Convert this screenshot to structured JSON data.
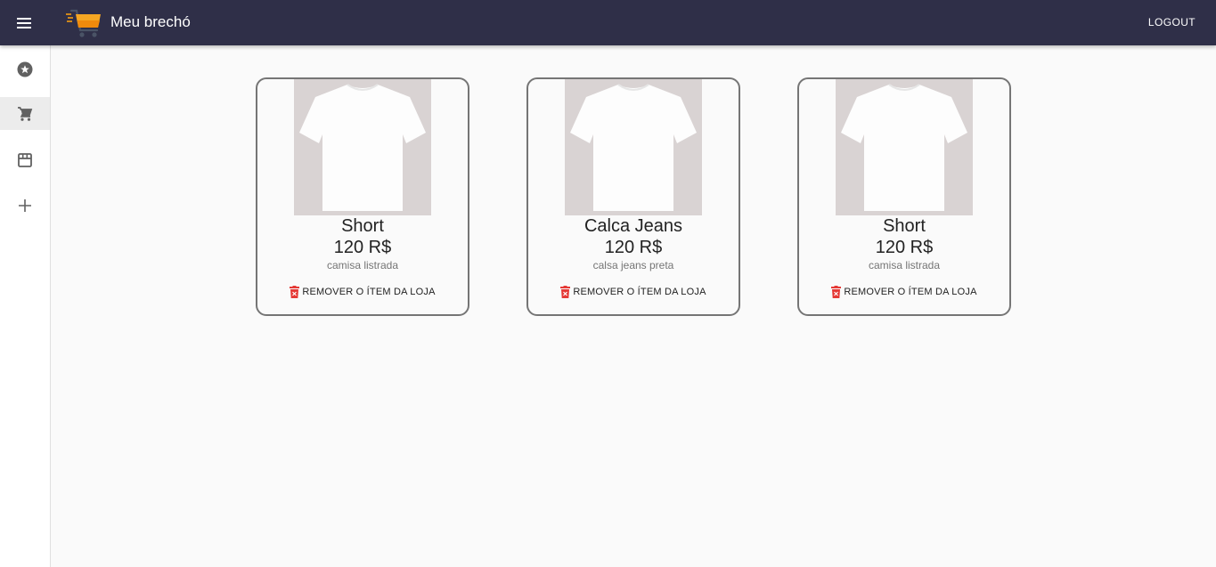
{
  "app": {
    "title": "Meu brechó",
    "logout_label": "LOGOUT",
    "menu_icon": "menu-icon",
    "logo_icon": "shopping-cart-logo"
  },
  "sidebar": {
    "items": [
      {
        "icon": "star-icon",
        "active": false
      },
      {
        "icon": "cart-icon",
        "active": true
      },
      {
        "icon": "store-icon",
        "active": false
      },
      {
        "icon": "plus-icon",
        "active": false
      }
    ]
  },
  "products": [
    {
      "name": "Short",
      "price": "120 R$",
      "description": "camisa listrada",
      "remove_label": "REMOVER O ÍTEM DA LOJA"
    },
    {
      "name": "Calca Jeans",
      "price": "120 R$",
      "description": "calsa jeans preta",
      "remove_label": "REMOVER O ÍTEM DA LOJA"
    },
    {
      "name": "Short",
      "price": "120 R$",
      "description": "camisa listrada",
      "remove_label": "REMOVER O ÍTEM DA LOJA"
    }
  ],
  "colors": {
    "appbar": "#2f2f48",
    "background": "#fafafa",
    "delete_icon": "#e53935"
  }
}
